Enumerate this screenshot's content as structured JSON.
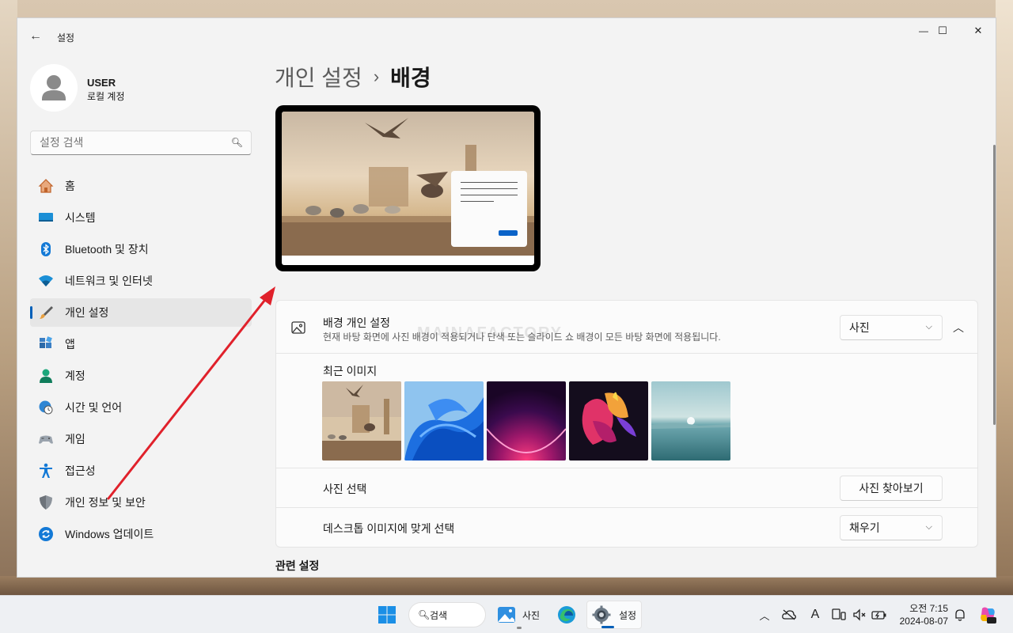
{
  "window": {
    "app_title": "설정",
    "controls": {
      "minimize": "—",
      "maximize": "☐",
      "close": "✕"
    }
  },
  "user": {
    "name": "USER",
    "account_type": "로컬 계정"
  },
  "search": {
    "placeholder": "설정 검색"
  },
  "nav": {
    "items": [
      {
        "label": "홈",
        "icon": "home-icon"
      },
      {
        "label": "시스템",
        "icon": "system-icon"
      },
      {
        "label": "Bluetooth 및 장치",
        "icon": "bluetooth-icon"
      },
      {
        "label": "네트워크 및 인터넷",
        "icon": "wifi-icon"
      },
      {
        "label": "개인 설정",
        "icon": "brush-icon",
        "active": true
      },
      {
        "label": "앱",
        "icon": "apps-icon"
      },
      {
        "label": "계정",
        "icon": "account-icon"
      },
      {
        "label": "시간 및 언어",
        "icon": "time-language-icon"
      },
      {
        "label": "게임",
        "icon": "gamepad-icon"
      },
      {
        "label": "접근성",
        "icon": "accessibility-icon"
      },
      {
        "label": "개인 정보 및 보안",
        "icon": "shield-icon"
      },
      {
        "label": "Windows 업데이트",
        "icon": "update-icon"
      }
    ]
  },
  "breadcrumb": {
    "parent": "개인 설정",
    "separator": "›",
    "current": "배경"
  },
  "background": {
    "title": "배경 개인 설정",
    "subtitle": "현재 바탕 화면에 사진 배경이 적용되거나 단색 또는 슬라이드 쇼 배경이 모든 바탕 화면에 적용됩니다.",
    "selected": "사진",
    "recent_label": "최근 이미지",
    "recent_images": [
      "birds-london-thumb",
      "blue-bloom-thumb",
      "purple-glow-thumb",
      "color-ribbon-thumb",
      "lake-sunrise-thumb"
    ],
    "choose_photo_label": "사진 선택",
    "browse_button": "사진 찾아보기",
    "fit_label": "데스크톱 이미지에 맞게 선택",
    "fit_selected": "채우기"
  },
  "related": {
    "title": "관련 설정"
  },
  "watermark": "MAINAFACTORY",
  "taskbar": {
    "search_label": "검색",
    "photos_label": "사진",
    "settings_label": "설정",
    "clock_period": "오전 7:15",
    "clock_date": "2024-08-07"
  },
  "colors": {
    "accent": "#005fb8",
    "annotation_arrow": "#e0212b"
  }
}
